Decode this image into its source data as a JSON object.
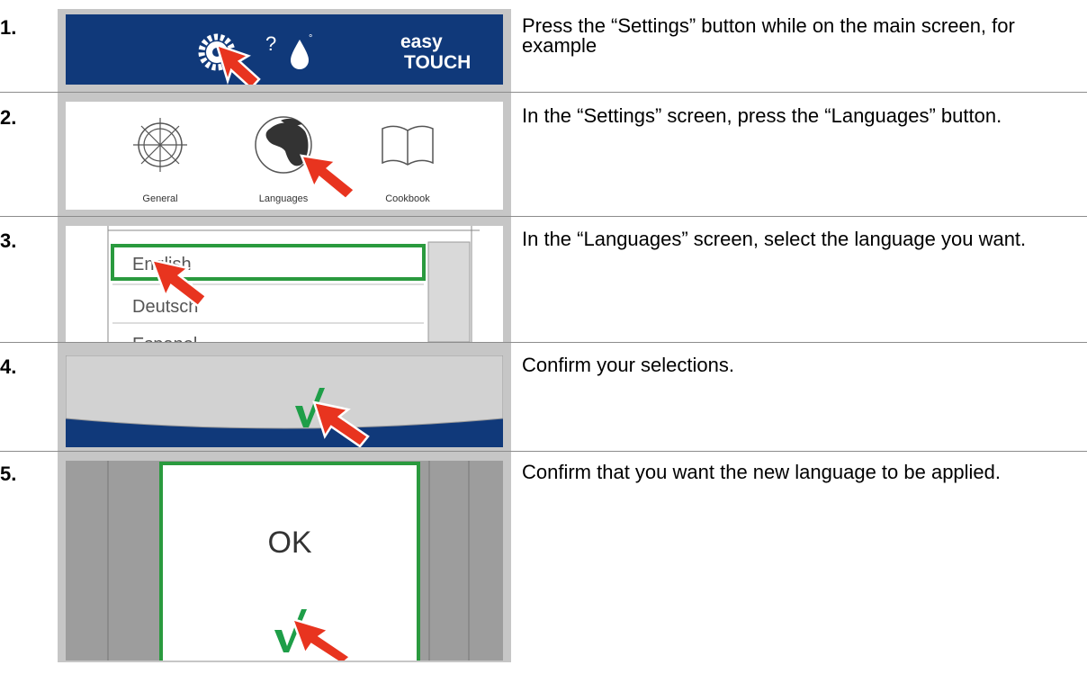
{
  "steps": [
    {
      "number": "1.",
      "text": "Press the “Settings” button while on the main screen, for example"
    },
    {
      "number": "2.",
      "text": "In the “Settings” screen, press the “Languages” button."
    },
    {
      "number": "3.",
      "text": "In the “Languages” screen, select the language you want."
    },
    {
      "number": "4.",
      "text": "Confirm your selections."
    },
    {
      "number": "5.",
      "text": "Confirm that you want the new language to be applied."
    }
  ],
  "screen1": {
    "logo_top": "easy",
    "logo_bottom": "TOUCH",
    "icons": [
      "gear-icon",
      "help-icon",
      "water-drop-icon"
    ]
  },
  "screen2": {
    "items": [
      {
        "label": "General",
        "icon": "ships-wheel-icon"
      },
      {
        "label": "Languages",
        "icon": "globe-icon"
      },
      {
        "label": "Cookbook",
        "icon": "book-icon"
      }
    ]
  },
  "screen3": {
    "languages": [
      "English",
      "Deutsch",
      "Espanol"
    ],
    "selected": "English"
  },
  "screen4": {
    "icon": "checkmark-icon"
  },
  "screen5": {
    "ok_label": "OK",
    "icon": "checkmark-icon"
  },
  "colors": {
    "brand_blue": "#10397a",
    "selection_green": "#2a9a3e",
    "check_green": "#1e9e48",
    "pointer_red": "#e8341f",
    "panel_gray": "#c6c6c6"
  }
}
